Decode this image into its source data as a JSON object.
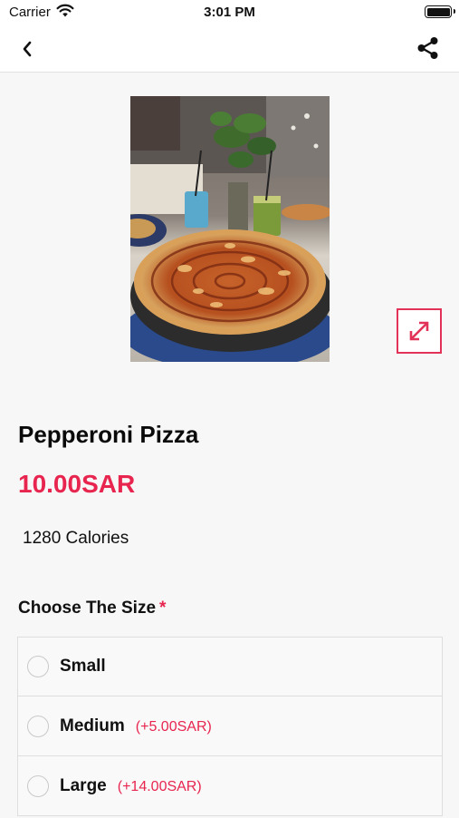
{
  "status_bar": {
    "carrier": "Carrier",
    "time": "3:01 PM"
  },
  "nav": {
    "back_icon": "chevron-left-icon",
    "share_icon": "share-icon"
  },
  "product": {
    "image_icon": "pizza-photo",
    "expand_icon": "expand-arrows-icon",
    "name": "Pepperoni Pizza",
    "price": "10.00SAR",
    "calories": "1280 Calories"
  },
  "size_section": {
    "heading": "Choose The Size",
    "required_mark": "*",
    "options": [
      {
        "label": "Small",
        "extra": ""
      },
      {
        "label": "Medium",
        "extra": "(+5.00SAR)"
      },
      {
        "label": "Large",
        "extra": "(+14.00SAR)"
      }
    ]
  },
  "colors": {
    "accent": "#e8254f",
    "background": "#f7f7f7"
  }
}
